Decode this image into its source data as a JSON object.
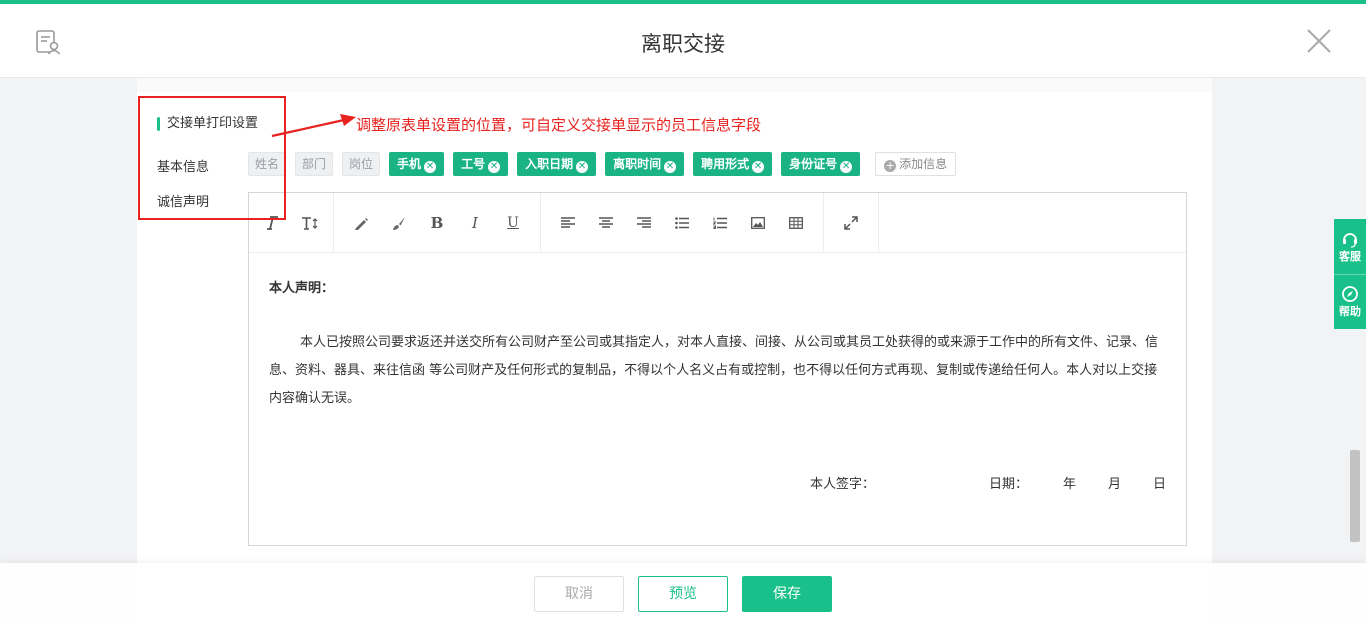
{
  "header": {
    "title": "离职交接",
    "logo_icon": "document-user-icon",
    "close_icon": "close-icon"
  },
  "section": {
    "title": "交接单打印设置",
    "basic_info_label": "基本信息",
    "integrity_label": "诚信声明"
  },
  "annotation": {
    "text": "调整原表单设置的位置，可自定义交接单显示的员工信息字段"
  },
  "tags": {
    "fixed": [
      "姓名",
      "部门",
      "岗位"
    ],
    "removable": [
      "手机",
      "工号",
      "入职日期",
      "离职时间",
      "聘用形式",
      "身份证号"
    ],
    "add_label": "添加信息"
  },
  "toolbar": {
    "icons": [
      "font-family-icon",
      "font-size-icon",
      "pen-icon",
      "brush-icon",
      "bold-icon",
      "italic-icon",
      "underline-icon",
      "align-left-icon",
      "align-center-icon",
      "align-right-icon",
      "bullet-list-icon",
      "numbered-list-icon",
      "image-icon",
      "table-icon",
      "fullscreen-icon"
    ]
  },
  "editor": {
    "heading": "本人声明：",
    "paragraph": "本人已按照公司要求返还并送交所有公司财产至公司或其指定人，对本人直接、间接、从公司或其员工处获得的或来源于工作中的所有文件、记录、信息、资料、器具、来往信函 等公司财产及任何形式的复制品，不得以个人名义占有或控制，也不得以任何方式再现、复制或传递给任何人。本人对以上交接内容确认无误。",
    "signature_label": "本人签字：",
    "date_label": "日期：",
    "year": "年",
    "month": "月",
    "day": "日"
  },
  "side": {
    "service_label": "客服",
    "help_label": "帮助"
  },
  "footer": {
    "cancel": "取消",
    "preview": "预览",
    "save": "保存"
  },
  "colors": {
    "accent": "#19c08a",
    "annotation_red": "#e8221f"
  }
}
